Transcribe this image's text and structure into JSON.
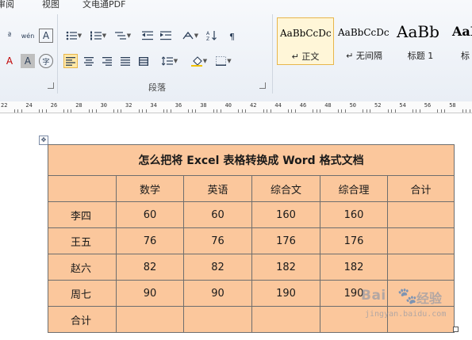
{
  "ribbon": {
    "menu": [
      "审阅",
      "视图",
      "文电通PDF"
    ],
    "paragraph_group_label": "段落",
    "font_row1": [
      {
        "icon": "phonetic-icon",
        "glyph": "ª"
      },
      {
        "icon": "wen-icon",
        "glyph": "wén"
      },
      {
        "icon": "char-border-icon",
        "glyph": "A"
      }
    ],
    "font_row2": [
      {
        "icon": "font-color-icon",
        "glyph": "A"
      },
      {
        "icon": "char-shading-icon",
        "glyph": "A"
      },
      {
        "icon": "enclose-char-icon",
        "glyph": "字"
      }
    ],
    "styles": [
      {
        "sample": "AaBbCcDc",
        "name": "↵ 正文",
        "selected": true
      },
      {
        "sample": "AaBbCcDc",
        "name": "↵ 无间隔",
        "selected": false
      },
      {
        "sample": "AaBb",
        "name": "标题 1",
        "selected": false
      },
      {
        "sample": "AaB",
        "name": "标",
        "selected": false
      }
    ]
  },
  "ruler": {
    "numbers": [
      "22",
      "24",
      "26",
      "28",
      "30",
      "32",
      "34",
      "36",
      "38",
      "40",
      "42",
      "44",
      "46",
      "48",
      "50",
      "52",
      "54",
      "56",
      "58"
    ]
  },
  "table": {
    "title": "怎么把将 Excel 表格转换成 Word 格式文档",
    "headers": [
      "",
      "数学",
      "英语",
      "综合文",
      "综合理",
      "合计"
    ],
    "rows": [
      {
        "name": "李四",
        "values": [
          "60",
          "60",
          "160",
          "160",
          ""
        ]
      },
      {
        "name": "王五",
        "values": [
          "76",
          "76",
          "176",
          "176",
          ""
        ]
      },
      {
        "name": "赵六",
        "values": [
          "82",
          "82",
          "182",
          "182",
          ""
        ]
      },
      {
        "name": "周七",
        "values": [
          "90",
          "90",
          "190",
          "190",
          ""
        ]
      },
      {
        "name": "合计",
        "values": [
          "",
          "",
          "",
          "",
          ""
        ]
      }
    ]
  },
  "watermark": {
    "brand": "Bai",
    "paw": "🐾",
    "brand_cn": "经验",
    "url": "jingyan.baidu.com"
  },
  "colors": {
    "table_fill": "#fbc79c",
    "table_border": "#6e6e6e",
    "active_button": "#ffe8a6",
    "selected_style": "#fff6d8"
  }
}
